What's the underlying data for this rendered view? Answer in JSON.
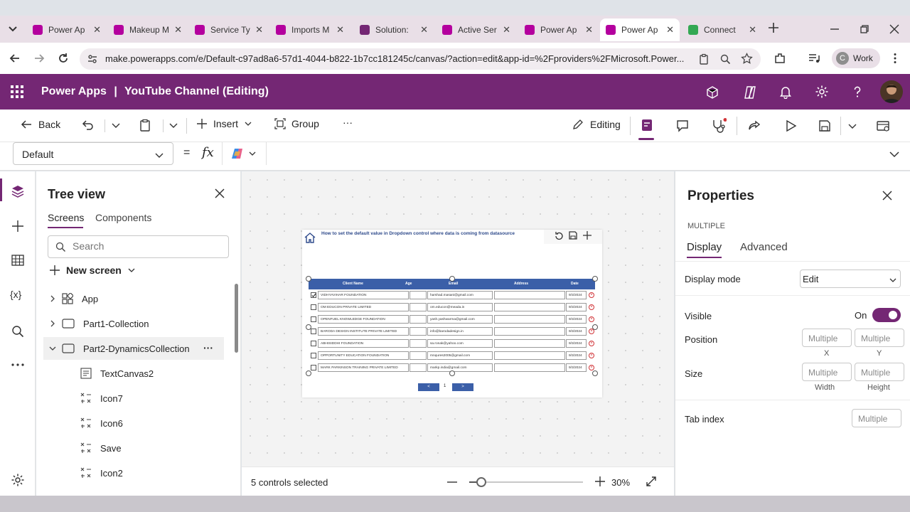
{
  "browser": {
    "tabs": [
      {
        "label": "Power Ap",
        "color": "#b4009e"
      },
      {
        "label": "Makeup M",
        "color": "#b4009e"
      },
      {
        "label": "Service Ty",
        "color": "#b4009e"
      },
      {
        "label": "Imports M",
        "color": "#b4009e"
      },
      {
        "label": "Solution:",
        "color": "#742774"
      },
      {
        "label": "Active Ser",
        "color": "#b4009e"
      },
      {
        "label": "Power Ap",
        "color": "#b4009e"
      },
      {
        "label": "Power Ap",
        "color": "#b4009e"
      },
      {
        "label": "Connect",
        "color": "#34a853"
      }
    ],
    "url": "make.powerapps.com/e/Default-c97ad8a6-57d1-4044-b822-1b7cc181245c/canvas/?action=edit&app-id=%2Fproviders%2FMicrosoft.Power...",
    "profile": {
      "initial": "C",
      "label": "Work"
    }
  },
  "app": {
    "brand": "Power Apps",
    "separator": "|",
    "title": "YouTube Channel (Editing)",
    "accent": "#742774"
  },
  "commands": {
    "back": "Back",
    "insert": "Insert",
    "group": "Group",
    "more": "···",
    "editing": "Editing"
  },
  "formula": {
    "property": "Default",
    "equals": "=",
    "fx": "fx"
  },
  "tree": {
    "title": "Tree view",
    "tabs": [
      "Screens",
      "Components"
    ],
    "search_placeholder": "Search",
    "new_screen": "New screen",
    "nodes": [
      "App",
      "Part1-Collection",
      "Part2-DynamicsCollection"
    ],
    "children": [
      "TextCanvas2",
      "Icon7",
      "Icon6",
      "Save",
      "Icon2"
    ],
    "node_more": "···"
  },
  "canvas": {
    "screen_title": "How to set the default value in Dropdown control where data is coming from datasource",
    "columns": [
      "Client Name",
      "Age",
      "Email",
      "Address",
      "Date"
    ],
    "rows": [
      {
        "name": "VIDHYAVIHAR FOUNDATION",
        "email": "harshad.masani@gmail.com",
        "date": "9/3/2024",
        "checked": true
      },
      {
        "name": "OM EDUCON PRIVATE LIMITED",
        "email": "om.educon@meada.in",
        "date": "9/3/2024",
        "checked": false
      },
      {
        "name": "OPENFUEL KNOWLEDGE FOUNDATION",
        "email": "yash.yashwarma@gmail.com",
        "date": "9/3/2024",
        "checked": false
      },
      {
        "name": "BARODA DESIGN INSTITUTE PRIVATE LIMITED",
        "email": "info@barodadesign.in",
        "date": "9/3/2024",
        "checked": false
      },
      {
        "name": "ABHISIDDHI FOUNDATION",
        "email": "sa.ronak@yahoo.com",
        "date": "9/3/2024",
        "checked": false
      },
      {
        "name": "OPPORTUNITY EDUCATION FOUNDATION",
        "email": "mnqures2005@gmail.com",
        "date": "9/3/2024",
        "checked": false
      },
      {
        "name": "MARK PARKINSON TRAINING PRIVATE LIMITED",
        "email": "markp.india@gmail.com",
        "date": "9/3/2024",
        "checked": false
      }
    ],
    "prev": "<",
    "page": "1",
    "next": ">"
  },
  "status": {
    "selection": "5 controls selected",
    "zoom": "30%",
    "zoom_level": 0.3
  },
  "properties": {
    "title": "Properties",
    "subtitle": "MULTIPLE",
    "tabs": [
      "Display",
      "Advanced"
    ],
    "display_mode_label": "Display mode",
    "display_mode_value": "Edit",
    "visible_label": "Visible",
    "visible_value": "On",
    "position_label": "Position",
    "size_label": "Size",
    "tab_index_label": "Tab index",
    "multiple": "Multiple",
    "x_label": "X",
    "y_label": "Y",
    "width_label": "Width",
    "height_label": "Height",
    "toggle_color": "#742774"
  }
}
